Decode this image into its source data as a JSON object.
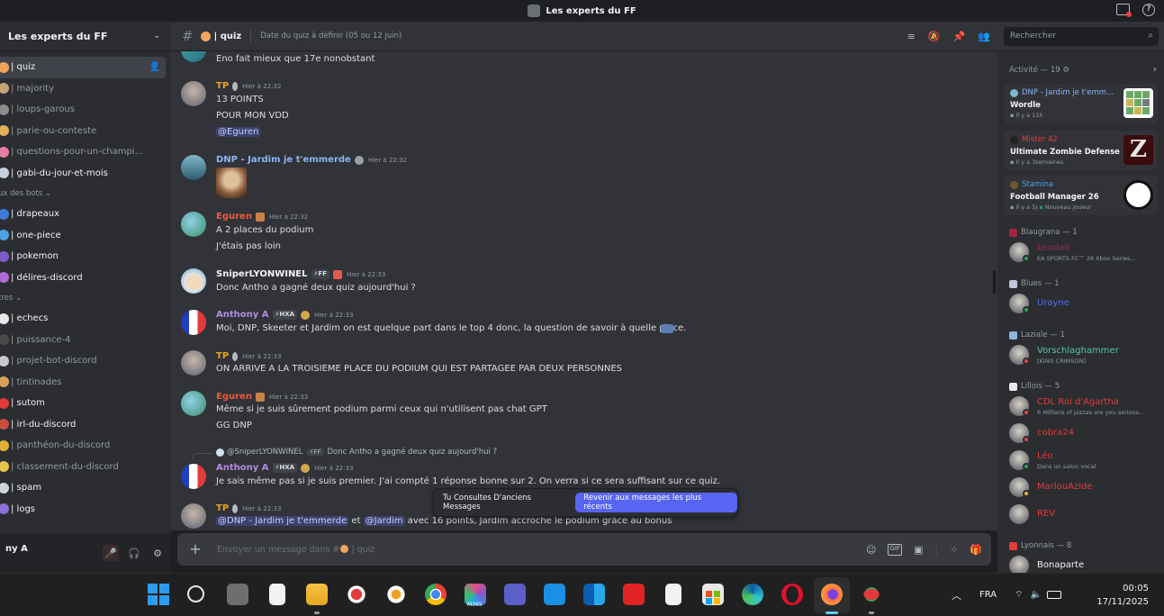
{
  "window": {
    "title": "Les experts du FF"
  },
  "server": {
    "name": "Les experts du FF"
  },
  "channels": [
    {
      "kind": "channel",
      "label": "| quiz",
      "color": "#f0a35e",
      "active": true,
      "unread": true
    },
    {
      "kind": "channel",
      "label": "| majority",
      "color": "#c9a27a",
      "unread": false
    },
    {
      "kind": "channel",
      "label": "| loups-garous",
      "color": "#8c8c8c",
      "unread": false
    },
    {
      "kind": "channel",
      "label": "| parie-ou-conteste",
      "color": "#e0b25b",
      "unread": false
    },
    {
      "kind": "channel",
      "label": "| questions-pour-un-champi...",
      "color": "#e67ea0",
      "unread": false
    },
    {
      "kind": "channel",
      "label": "| gabi-du-jour-et-mois",
      "color": "#c8d2da",
      "unread": true
    },
    {
      "kind": "category",
      "label": "ux des bots ⌄"
    },
    {
      "kind": "channel",
      "label": "| drapeaux",
      "color": "#3f7ad9",
      "unread": true
    },
    {
      "kind": "channel",
      "label": "| one-piece",
      "color": "#4aa3df",
      "unread": true
    },
    {
      "kind": "channel",
      "label": "| pokemon",
      "color": "#7b5cc9",
      "unread": true
    },
    {
      "kind": "channel",
      "label": "| délires-discord",
      "color": "#b36bd6",
      "unread": true
    },
    {
      "kind": "category",
      "label": "tres ⌄"
    },
    {
      "kind": "channel",
      "label": "| echecs",
      "color": "#e8e8e8",
      "unread": true
    },
    {
      "kind": "channel",
      "label": "| puissance-4",
      "color": "#4b4b4b",
      "unread": false
    },
    {
      "kind": "channel",
      "label": "| projet-bot-discord",
      "color": "#c9c9c9",
      "unread": false
    },
    {
      "kind": "channel",
      "label": "| tintinades",
      "color": "#d9a25b",
      "unread": false
    },
    {
      "kind": "channel",
      "label": "| sutom",
      "color": "#e23b3b",
      "unread": true
    },
    {
      "kind": "channel",
      "label": "| irl-du-discord",
      "color": "#c94d3d",
      "unread": true
    },
    {
      "kind": "channel",
      "label": "| panthéon-du-discord",
      "color": "#e0b030",
      "unread": false
    },
    {
      "kind": "channel",
      "label": "| classement-du-discord",
      "color": "#e8c24a",
      "unread": false
    },
    {
      "kind": "channel",
      "label": "| spam",
      "color": "#cfd3d8",
      "unread": true
    },
    {
      "kind": "channel",
      "label": "| logs",
      "color": "#8f6fd6",
      "unread": true
    }
  ],
  "user": {
    "name": "ny A"
  },
  "header": {
    "channel": "| quiz",
    "topic": "Date du quiz à définir (05 ou 12 juin)",
    "search_placeholder": "Rechercher"
  },
  "messages": [
    {
      "id": "m0",
      "author": "",
      "lines": [
        "Eno fait mieux que 17e nonobstant"
      ]
    },
    {
      "id": "m1",
      "author": "TP",
      "author_color": "#e6a521",
      "time": "Hier à 22:32",
      "badge": "",
      "lines": [
        "13 POINTS",
        "POUR MON VDD",
        "@Eguren"
      ]
    },
    {
      "id": "m2",
      "author": "DNP - Jardim je t'emmerde",
      "author_color": "#8ab4f8",
      "time": "Hier à 22:32",
      "badge": ""
    },
    {
      "id": "m3",
      "author": "Eguren",
      "author_color": "#ec5b3b",
      "time": "Hier à 22:32",
      "badge": "",
      "lines": [
        "A 2 places du podium",
        "J'étais pas loin"
      ]
    },
    {
      "id": "m4",
      "author": "SniperLYONWINEL",
      "author_color": "#f2f3f5",
      "time": "Hier à 22:33",
      "badge": "⚡FF",
      "lines": [
        "Donc Antho a gagné deux quiz aujourd'hui ?"
      ]
    },
    {
      "id": "m5",
      "author": "Anthony A",
      "author_color": "#b28be0",
      "time": "Hier à 22:33",
      "badge": "⚡HXA",
      "lines": [
        "Moi, DNP, Skeeter et Jardim on est quelque part dans le top 4 donc, la question de savoir à quelle place."
      ]
    },
    {
      "id": "m6",
      "author": "TP",
      "author_color": "#e6a521",
      "time": "Hier à 22:33",
      "badge": "",
      "lines": [
        "ON ARRIVE A LA TROISIEME PLACE DU PODIUM QUI EST PARTAGEE PAR DEUX PERSONNES"
      ]
    },
    {
      "id": "m7",
      "author": "Eguren",
      "author_color": "#ec5b3b",
      "time": "Hier à 22:33",
      "badge": "",
      "lines": [
        "Même si je suis sûrement podium parmi ceux qui n'utilisent pas chat GPT",
        "GG DNP"
      ]
    },
    {
      "id": "m8",
      "author": "Anthony A",
      "author_color": "#b28be0",
      "time": "Hier à 22:33",
      "badge": "⚡HXA",
      "reply_author": "@SniperLYONWINEL",
      "reply_badge": "⚡FF",
      "reply_text": "Donc Antho a gagné deux quiz aujourd'hui ?",
      "lines": [
        "Je sais même pas si je suis premier. J'ai compté 1 réponse bonne sur 2. On verra si ce sera suffisant sur ce quiz."
      ]
    },
    {
      "id": "m9",
      "author": "TP",
      "author_color": "#e6a521",
      "time": "Hier à 22:33",
      "badge": "",
      "mention1": "@DNP - Jardim je t'emmerde",
      "mid": "et",
      "mention2": "@Jardim",
      "rest": "avec 16 points, Jardim accroche le podium grâce au bonus"
    }
  ],
  "new_messages_bar": {
    "text": "Tu Consultes D'anciens Messages",
    "button": "Revenir aux messages les plus récents"
  },
  "composer": {
    "placeholder": "Envoyer un message dans #",
    "channel": "| quiz"
  },
  "activity": {
    "title": "Activité — 19",
    "cards": [
      {
        "user": "DNP - Jardim je t'emm...",
        "user_color": "#8ab4f8",
        "game": "Wordle",
        "time": "Il y a 11h",
        "extra": ""
      },
      {
        "user": "Mister 42",
        "user_color": "#e23b3b",
        "game": "Ultimate Zombie Defense",
        "time": "Il y a 3semaines",
        "extra": ""
      },
      {
        "user": "Stamina",
        "user_color": "#4aa3df",
        "game": "Football Manager 26",
        "time": "Il y a 5j",
        "extra": "Nouveau joueur"
      }
    ]
  },
  "member_groups": [
    {
      "title": "Blaugrana — 1",
      "members": [
        {
          "name": "kendall",
          "color": "#8a3050",
          "sub": "EA SPORTS FC™ 26 Xbox Series...",
          "status": "#23a55a"
        }
      ]
    },
    {
      "title": "Blues — 1",
      "members": [
        {
          "name": "Urayne",
          "color": "#4e6ef0",
          "sub": "",
          "status": "#23a55a"
        }
      ]
    },
    {
      "title": "Laziale — 1",
      "members": [
        {
          "name": "Vorschlaghammer",
          "color": "#58c7a0",
          "sub": "[KING CRIMSON]",
          "status": "#f23f43"
        }
      ]
    },
    {
      "title": "Lillois — 5",
      "members": [
        {
          "name": "CDL Roi d'Agartha",
          "color": "#e23b3b",
          "sub": "6 Millions of pizzas are you serious...",
          "status": "#f23f43"
        },
        {
          "name": "cobra24",
          "color": "#e23b3b",
          "sub": "",
          "status": "#f23f43"
        },
        {
          "name": "Léo",
          "color": "#e23b3b",
          "sub": "Dans un salon vocal",
          "status": "#23a55a"
        },
        {
          "name": "MarlouAzide",
          "color": "#e23b3b",
          "sub": "",
          "status": "#f0b232"
        },
        {
          "name": "REV",
          "color": "#e23b3b",
          "sub": "",
          "status": ""
        }
      ]
    },
    {
      "title": "Lyonnais — 8",
      "members": [
        {
          "name": "Bonaparte",
          "color": "#f2f3f5",
          "sub": "",
          "status": ""
        }
      ]
    }
  ],
  "taskbar": {
    "lang": "FRA",
    "time": "00:05",
    "date": "17/11/2025",
    "m365_label": "M365"
  }
}
